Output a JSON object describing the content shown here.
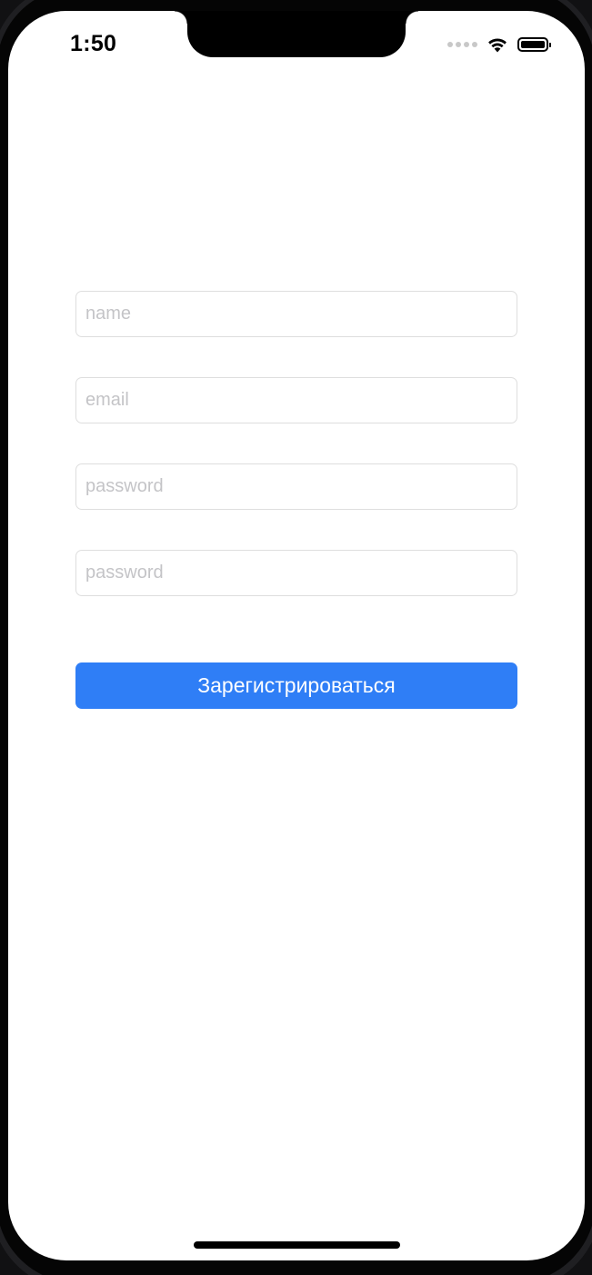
{
  "status_bar": {
    "time": "1:50",
    "wifi_icon": "wifi-icon",
    "battery_icon": "battery-icon",
    "signal_icon": "cellular-signal-icon"
  },
  "form": {
    "name": {
      "placeholder": "name",
      "value": ""
    },
    "email": {
      "placeholder": "email",
      "value": ""
    },
    "password": {
      "placeholder": "password",
      "value": ""
    },
    "password_confirm": {
      "placeholder": "password",
      "value": ""
    },
    "submit_label": "Зарегистрироваться"
  },
  "colors": {
    "accent": "#2f7ef6",
    "background": "#ffffff",
    "field_border": "#dedede",
    "placeholder": "#c4c4c7"
  }
}
